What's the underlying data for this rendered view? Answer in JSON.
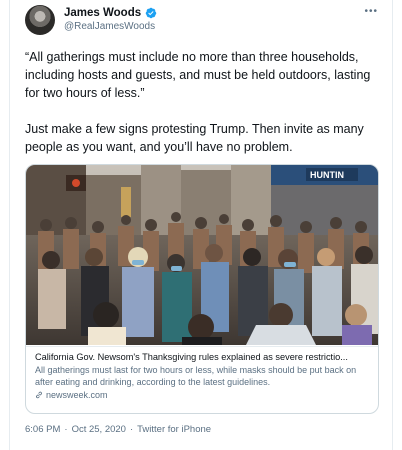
{
  "author": {
    "name": "James Woods",
    "handle": "@RealJamesWoods"
  },
  "tweet": {
    "paragraph1": "“All gatherings must include no more than three households, including hosts and guests, and must be held outdoors, lasting for two hours of less.”",
    "paragraph2": "Just make a few signs protesting Trump. Then invite as many people as you want, and you’ll have no problem."
  },
  "card": {
    "title": "California Gov. Newsom's Thanksgiving rules explained as severe restrictio...",
    "description": "All gatherings must last for two hours or less, while masks should be put back on after eating and drinking, according to the latest guidelines.",
    "domain": "newsweek.com",
    "image_signs": [
      "HUNTIN"
    ]
  },
  "footer": {
    "time": "6:06 PM",
    "separator1": "·",
    "date": "Oct 25, 2020",
    "separator2": "·",
    "source": "Twitter for iPhone"
  },
  "colors": {
    "verified": "#1da1f2",
    "secondary_text": "#5b7083",
    "border": "#cfd9de"
  },
  "icons": {
    "verified": "verified-badge-icon",
    "more": "more-options-icon",
    "link": "link-icon"
  }
}
